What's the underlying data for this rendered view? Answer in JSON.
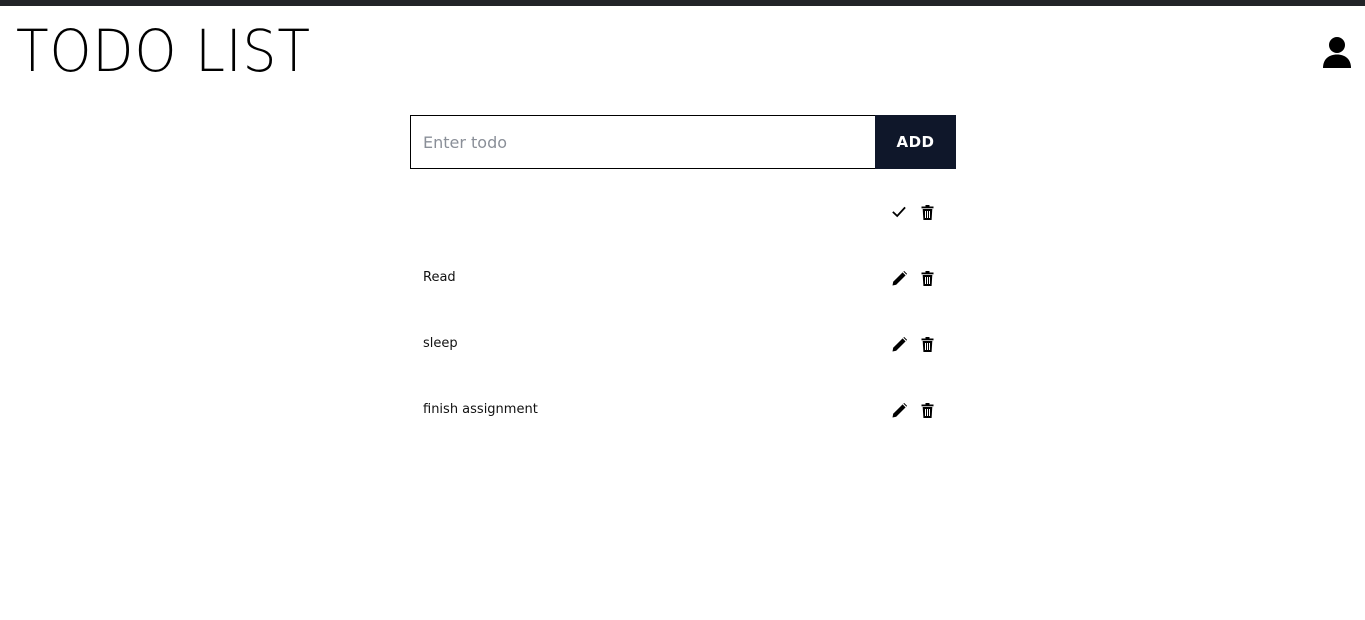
{
  "header": {
    "title": "TODO LIST",
    "user_icon": "user-icon"
  },
  "form": {
    "placeholder": "Enter todo",
    "value": "",
    "add_label": "ADD"
  },
  "todos": [
    {
      "text": "",
      "editing": true,
      "primary_icon": "check-icon",
      "secondary_icon": "trash-icon"
    },
    {
      "text": "Read",
      "editing": false,
      "primary_icon": "pencil-icon",
      "secondary_icon": "trash-icon"
    },
    {
      "text": "sleep",
      "editing": false,
      "primary_icon": "pencil-icon",
      "secondary_icon": "trash-icon"
    },
    {
      "text": "finish assignment",
      "editing": false,
      "primary_icon": "pencil-icon",
      "secondary_icon": "trash-icon"
    }
  ],
  "colors": {
    "top_bar": "#222428",
    "add_button_bg": "#0f172a",
    "add_button_text": "#ffffff"
  }
}
